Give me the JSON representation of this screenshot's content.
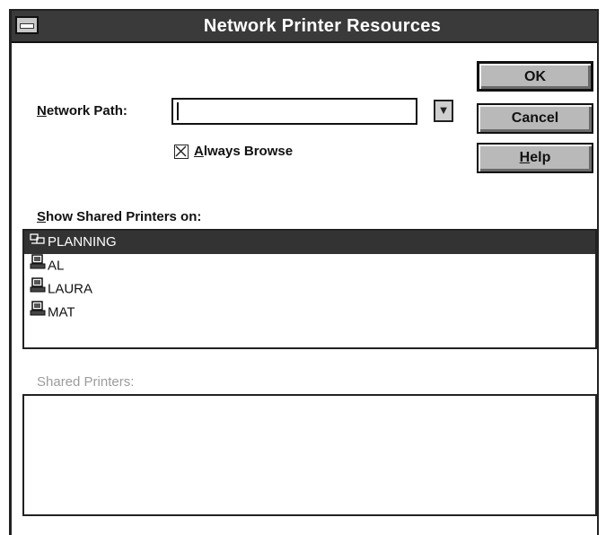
{
  "window": {
    "title": "Network Printer Resources"
  },
  "form": {
    "network_path_label": "Network Path:",
    "network_path_label_key": "N",
    "network_path_label_rest": "etwork Path:",
    "network_path_value": "",
    "always_browse_key": "A",
    "always_browse_rest": "lways Browse",
    "always_browse_checked": true
  },
  "buttons": {
    "ok": "OK",
    "cancel": "Cancel",
    "help_key": "H",
    "help_rest": "elp"
  },
  "shared_printers_on": {
    "label_key": "S",
    "label_rest": "how Shared Printers on:",
    "items": [
      {
        "label": "PLANNING",
        "icon": "workgroup-icon",
        "selected": true
      },
      {
        "label": "AL",
        "icon": "computer-icon",
        "selected": false
      },
      {
        "label": "LAURA",
        "icon": "computer-icon",
        "selected": false
      },
      {
        "label": "MAT",
        "icon": "computer-icon",
        "selected": false
      }
    ]
  },
  "shared_printers": {
    "label": "Shared Printers:",
    "items": []
  }
}
